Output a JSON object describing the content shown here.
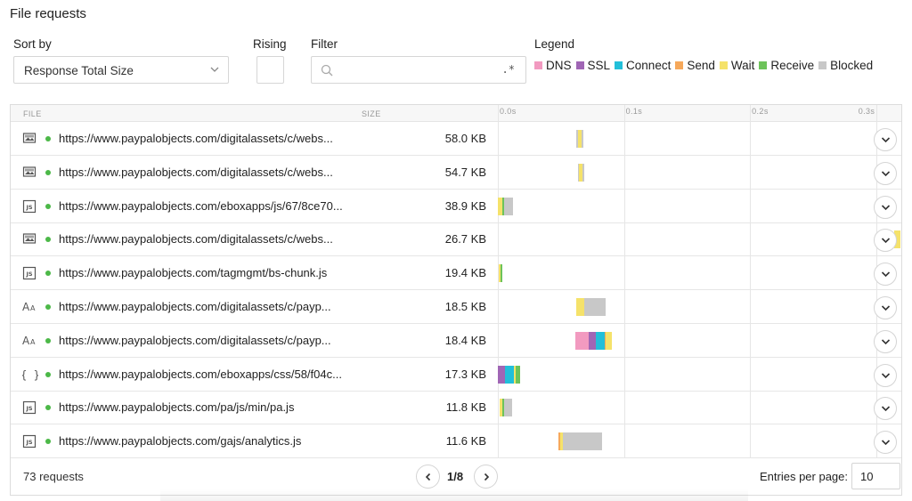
{
  "title": "File requests",
  "controls": {
    "sort_label": "Sort by",
    "sort_value": "Response Total Size",
    "rising_label": "Rising",
    "filter_label": "Filter",
    "filter_value": "",
    "filter_regex": ".*",
    "legend_label": "Legend"
  },
  "legend": [
    {
      "label": "DNS",
      "color": "#f29ac0"
    },
    {
      "label": "SSL",
      "color": "#a066b5"
    },
    {
      "label": "Connect",
      "color": "#22bfd9"
    },
    {
      "label": "Send",
      "color": "#f6a85a"
    },
    {
      "label": "Wait",
      "color": "#f5e26a"
    },
    {
      "label": "Receive",
      "color": "#6dc35a"
    },
    {
      "label": "Blocked",
      "color": "#c8c8c8"
    }
  ],
  "table": {
    "col_file": "FILE",
    "col_size": "SIZE",
    "ticks": [
      "0.0s",
      "0.1s",
      "0.2s",
      "0.3s"
    ],
    "rows": [
      {
        "icon": "image-icon",
        "url": "https://www.paypalobjects.com/digitalassets/c/webs...",
        "size": "58.0 KB",
        "timing": [
          {
            "type": "Blocked",
            "start": 0.0623,
            "duration": 0.0014
          },
          {
            "type": "Wait",
            "start": 0.0637,
            "duration": 0.0028
          },
          {
            "type": "Blocked",
            "start": 0.0665,
            "duration": 0.0007
          }
        ]
      },
      {
        "icon": "image-icon",
        "url": "https://www.paypalobjects.com/digitalassets/c/webs...",
        "size": "54.7 KB",
        "timing": [
          {
            "type": "Blocked",
            "start": 0.0637,
            "duration": 0.0007
          },
          {
            "type": "Wait",
            "start": 0.0644,
            "duration": 0.0028
          },
          {
            "type": "Blocked",
            "start": 0.0672,
            "duration": 0.0007
          }
        ]
      },
      {
        "icon": "js-icon",
        "url": "https://www.paypalobjects.com/eboxapps/js/67/8ce70...",
        "size": "38.9 KB",
        "timing": [
          {
            "type": "Wait",
            "start": 0.0,
            "duration": 0.0035
          },
          {
            "type": "Receive",
            "start": 0.0035,
            "duration": 0.0014
          },
          {
            "type": "Blocked",
            "start": 0.0049,
            "duration": 0.007
          }
        ]
      },
      {
        "icon": "image-icon",
        "url": "https://www.paypalobjects.com/digitalassets/c/webs...",
        "size": "26.7 KB",
        "timing": [
          {
            "type": "Wait",
            "start": 0.3145,
            "duration": 0.0049
          }
        ]
      },
      {
        "icon": "js-icon",
        "url": "https://www.paypalobjects.com/tagmgmt/bs-chunk.js",
        "size": "19.4 KB",
        "timing": [
          {
            "type": "Wait",
            "start": 0.0007,
            "duration": 0.0014
          },
          {
            "type": "Receive",
            "start": 0.0021,
            "duration": 0.0014
          }
        ]
      },
      {
        "icon": "font-icon",
        "url": "https://www.paypalobjects.com/digitalassets/c/payp...",
        "size": "18.5 KB",
        "timing": [
          {
            "type": "Wait",
            "start": 0.0623,
            "duration": 0.0063
          },
          {
            "type": "Blocked",
            "start": 0.0686,
            "duration": 0.0169
          }
        ]
      },
      {
        "icon": "font-icon",
        "url": "https://www.paypalobjects.com/digitalassets/c/payp...",
        "size": "18.4 KB",
        "timing": [
          {
            "type": "DNS",
            "start": 0.0616,
            "duration": 0.0105
          },
          {
            "type": "SSL",
            "start": 0.0721,
            "duration": 0.0056
          },
          {
            "type": "Connect",
            "start": 0.0777,
            "duration": 0.007
          },
          {
            "type": "Send",
            "start": 0.0847,
            "duration": 0.0007
          },
          {
            "type": "Wait",
            "start": 0.0854,
            "duration": 0.0049
          }
        ]
      },
      {
        "icon": "css-icon",
        "url": "https://www.paypalobjects.com/eboxapps/css/58/f04c...",
        "size": "17.3 KB",
        "timing": [
          {
            "type": "SSL",
            "start": 0.0,
            "duration": 0.0056
          },
          {
            "type": "Connect",
            "start": 0.0056,
            "duration": 0.007
          },
          {
            "type": "Wait",
            "start": 0.0126,
            "duration": 0.0014
          },
          {
            "type": "Receive",
            "start": 0.014,
            "duration": 0.0035
          }
        ]
      },
      {
        "icon": "js-icon",
        "url": "https://www.paypalobjects.com/pa/js/min/pa.js",
        "size": "11.8 KB",
        "timing": [
          {
            "type": "Wait",
            "start": 0.0014,
            "duration": 0.0021
          },
          {
            "type": "Receive",
            "start": 0.0035,
            "duration": 0.0014
          },
          {
            "type": "Blocked",
            "start": 0.0049,
            "duration": 0.0063
          }
        ]
      },
      {
        "icon": "js-icon",
        "url": "https://www.paypalobjects.com/gajs/analytics.js",
        "size": "11.6 KB",
        "timing": [
          {
            "type": "Send",
            "start": 0.0483,
            "duration": 0.0014
          },
          {
            "type": "Wait",
            "start": 0.0497,
            "duration": 0.0021
          },
          {
            "type": "Blocked",
            "start": 0.0518,
            "duration": 0.031
          }
        ]
      }
    ]
  },
  "timeline": {
    "min": 0,
    "max": 0.32
  },
  "footer": {
    "count": "73 requests",
    "page": "1/8",
    "epp_label": "Entries per page:",
    "epp_value": "10"
  }
}
